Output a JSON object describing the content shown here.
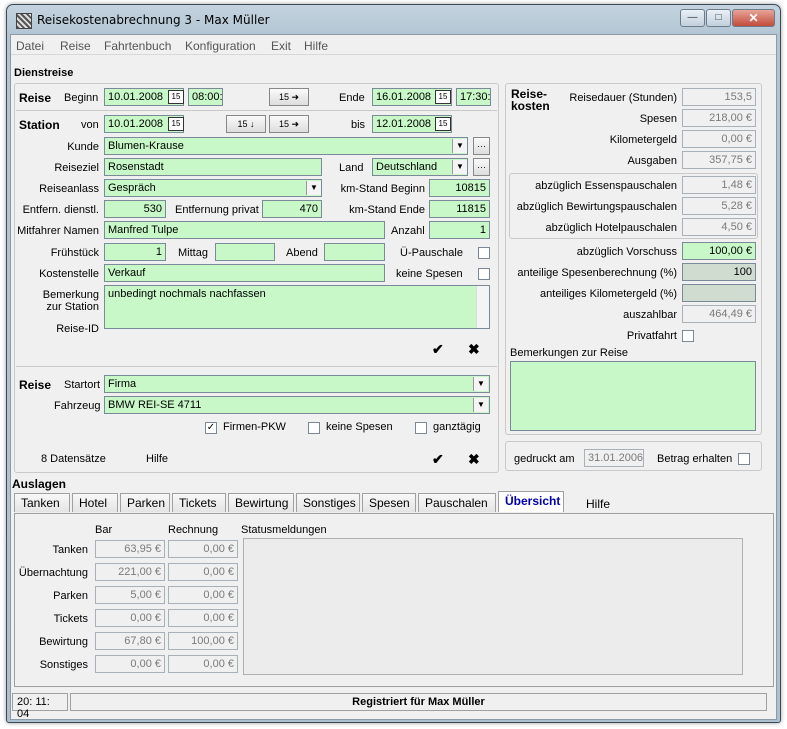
{
  "window": {
    "title": "Reisekostenabrechnung 3 - Max Müller",
    "min": "—",
    "max": "□",
    "close": "✕"
  },
  "menu": [
    "Datei",
    "Reise",
    "Fahrtenbuch",
    "Konfiguration",
    "Exit",
    "Hilfe"
  ],
  "section_title": "Dienstreise",
  "reise": {
    "label": "Reise",
    "beginn_label": "Beginn",
    "beginn_date": "10.01.2008",
    "beginn_time": "08:00:",
    "ende_label": "Ende",
    "ende_date": "16.01.2008",
    "ende_time": "17:30:",
    "cal_icon": "15",
    "copy_btn": "15 ➜"
  },
  "station": {
    "label": "Station",
    "von_label": "von",
    "von_date": "10.01.2008",
    "bis_label": "bis",
    "bis_date": "12.01.2008",
    "copy_down": "15 ↓",
    "copy_right": "15 ➜",
    "kunde_label": "Kunde",
    "kunde": "Blumen-Krause",
    "reiseziel_label": "Reiseziel",
    "reiseziel": "Rosenstadt",
    "land_label": "Land",
    "land": "Deutschland",
    "reiseanlass_label": "Reiseanlass",
    "reiseanlass": "Gespräch",
    "km_beginn_label": "km-Stand Beginn",
    "km_beginn": "10815",
    "entf_dienstl_label": "Entfern. dienstl.",
    "entf_dienstl": "530",
    "entf_privat_label": "Entfernung privat",
    "entf_privat": "470",
    "km_ende_label": "km-Stand Ende",
    "km_ende": "11815",
    "mitfahrer_label": "Mitfahrer Namen",
    "mitfahrer": "Manfred Tulpe",
    "anzahl_label": "Anzahl",
    "anzahl": "1",
    "fruehstueck_label": "Frühstück",
    "fruehstueck": "1",
    "mittag_label": "Mittag",
    "mittag": "",
    "abend_label": "Abend",
    "abend": "",
    "ue_pauschale_label": "Ü-Pauschale",
    "kostenstelle_label": "Kostenstelle",
    "kostenstelle": "Verkauf",
    "keine_spesen_label": "keine Spesen",
    "bemerkung_label1": "Bemerkung",
    "bemerkung_label2": "zur Station",
    "bemerkung": "unbedingt nochmals nachfassen",
    "reise_id_label": "Reise-ID"
  },
  "fahrt": {
    "label": "Reise",
    "startort_label": "Startort",
    "startort": "Firma",
    "fahrzeug_label": "Fahrzeug",
    "fahrzeug": "BMW REI-SE 4711",
    "firmen_pkw": "Firmen-PKW",
    "keine_spesen": "keine Spesen",
    "ganztaegig": "ganztägig"
  },
  "footer": {
    "datensaetze": "8 Datensätze",
    "hilfe": "Hilfe"
  },
  "costs": {
    "title1": "Reise-",
    "title2": "kosten",
    "rows": [
      {
        "label": "Reisedauer (Stunden)",
        "value": "153,5"
      },
      {
        "label": "Spesen",
        "value": "218,00 €"
      },
      {
        "label": "Kilometergeld",
        "value": "0,00 €"
      },
      {
        "label": "Ausgaben",
        "value": "357,75 €"
      }
    ],
    "abz": [
      {
        "label": "abzüglich Essenspauschalen",
        "value": "1,48 €"
      },
      {
        "label": "abzüglich Bewirtungspauschalen",
        "value": "5,28 €"
      },
      {
        "label": "abzüglich Hotelpauschalen",
        "value": "4,50 €"
      }
    ],
    "vorschuss_label": "abzüglich Vorschuss",
    "vorschuss": "100,00 €",
    "anteil_spesen_label": "anteilige Spesenberechnung (%)",
    "anteil_spesen": "100",
    "anteil_km_label": "anteiliges Kilometergeld (%)",
    "anteil_km": "",
    "auszahlbar_label": "auszahlbar",
    "auszahlbar": "464,49 €",
    "privatfahrt_label": "Privatfahrt",
    "bemerkungen_label": "Bemerkungen zur Reise",
    "gedruckt_label": "gedruckt am",
    "gedruckt": "31.01.2006",
    "betrag_label": "Betrag erhalten"
  },
  "auslagen": {
    "title": "Auslagen",
    "tabs": [
      "Tanken",
      "Hotel",
      "Parken",
      "Tickets",
      "Bewirtung",
      "Sonstiges",
      "Spesen",
      "Pauschalen",
      "Übersicht",
      "Hilfe"
    ],
    "col_bar": "Bar",
    "col_rechnung": "Rechnung",
    "col_status": "Statusmeldungen",
    "rows": [
      {
        "label": "Tanken",
        "bar": "63,95 €",
        "rechnung": "0,00 €"
      },
      {
        "label": "Übernachtung",
        "bar": "221,00 €",
        "rechnung": "0,00 €"
      },
      {
        "label": "Parken",
        "bar": "5,00 €",
        "rechnung": "0,00 €"
      },
      {
        "label": "Tickets",
        "bar": "0,00 €",
        "rechnung": "0,00 €"
      },
      {
        "label": "Bewirtung",
        "bar": "67,80 €",
        "rechnung": "100,00 €"
      },
      {
        "label": "Sonstiges",
        "bar": "0,00 €",
        "rechnung": "0,00 €"
      }
    ]
  },
  "statusbar": {
    "time": "20: 11: 04",
    "registered": "Registriert für Max Müller"
  },
  "icons": {
    "ok": "✔",
    "cancel": "✖",
    "dots": "···",
    "drop": "▼",
    "check": "✓"
  }
}
